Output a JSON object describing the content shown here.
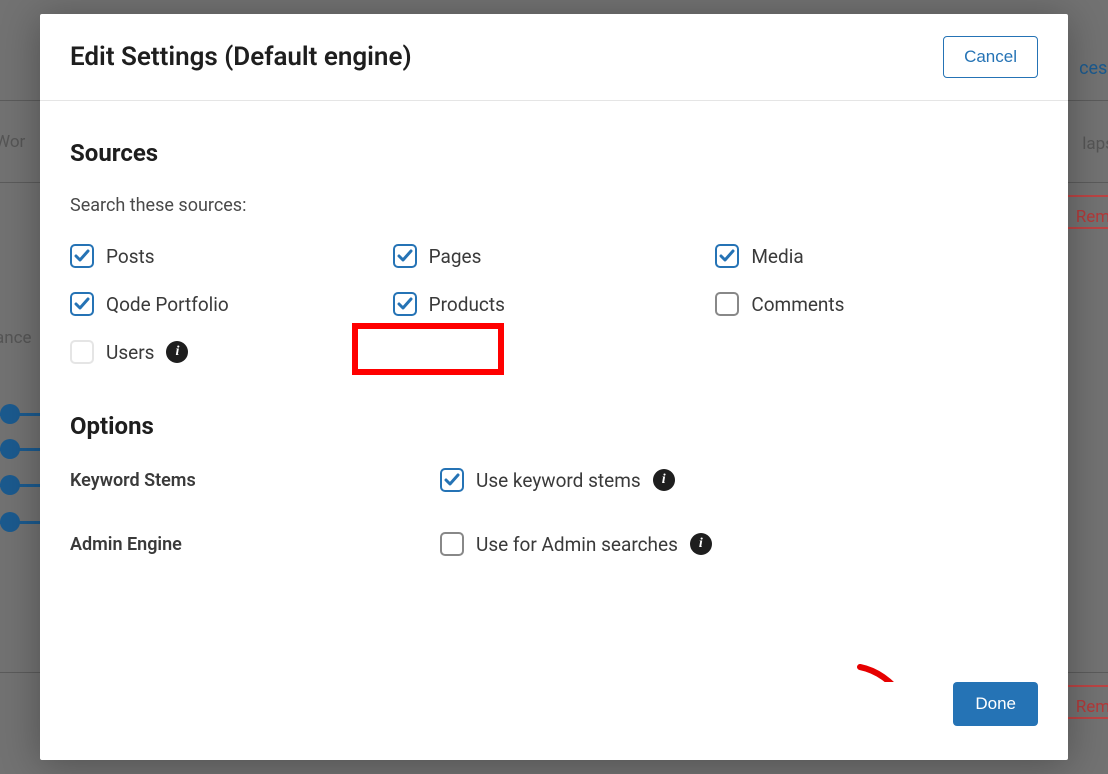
{
  "header": {
    "title": "Edit Settings (Default engine)",
    "cancel": "Cancel"
  },
  "sources": {
    "heading": "Sources",
    "subheading": "Search these sources:",
    "items": [
      {
        "label": "Posts",
        "checked": true,
        "disabled": false
      },
      {
        "label": "Pages",
        "checked": true,
        "disabled": false
      },
      {
        "label": "Media",
        "checked": true,
        "disabled": false
      },
      {
        "label": "Qode Portfolio",
        "checked": true,
        "disabled": false
      },
      {
        "label": "Products",
        "checked": true,
        "disabled": false,
        "highlighted": true
      },
      {
        "label": "Comments",
        "checked": false,
        "disabled": false
      },
      {
        "label": "Users",
        "checked": false,
        "disabled": true,
        "info": true
      }
    ]
  },
  "options": {
    "heading": "Options",
    "rows": [
      {
        "label": "Keyword Stems",
        "control_label": "Use keyword stems",
        "checked": true,
        "info": true
      },
      {
        "label": "Admin Engine",
        "control_label": "Use for Admin searches",
        "checked": false,
        "info": true
      }
    ]
  },
  "footer": {
    "done": "Done"
  },
  "background": {
    "left1": "Wor",
    "left2": "ance",
    "right_top": "ces &",
    "right1": "lapse",
    "remov": "Remov"
  }
}
